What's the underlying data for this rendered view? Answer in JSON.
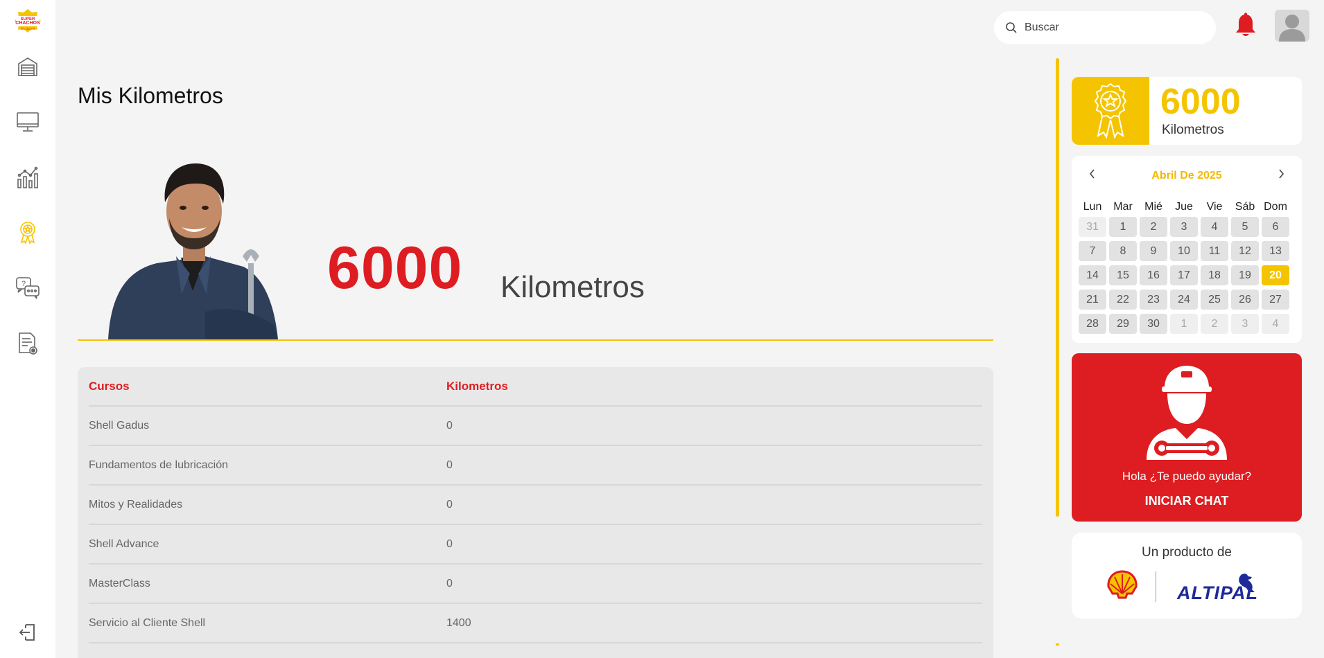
{
  "sidebar": {
    "logo_text": [
      "SUPER",
      "CHACHOS",
      "DEL MOTOR"
    ],
    "items": [
      {
        "icon": "garage-icon"
      },
      {
        "icon": "monitor-icon"
      },
      {
        "icon": "stats-icon"
      },
      {
        "icon": "award-icon",
        "active": true
      },
      {
        "icon": "chat-help-icon"
      },
      {
        "icon": "document-icon"
      }
    ],
    "logout_icon": "logout-icon"
  },
  "header": {
    "search_placeholder": "Buscar",
    "bell_icon": "bell-icon",
    "avatar_icon": "user-icon"
  },
  "main": {
    "title": "Mis Kilometros",
    "hero_value": "6000",
    "hero_unit": "Kilometros",
    "table": {
      "headers": [
        "Cursos",
        "Kilometros"
      ],
      "rows": [
        {
          "course": "Shell Gadus",
          "km": "0"
        },
        {
          "course": "Fundamentos de lubricación",
          "km": "0"
        },
        {
          "course": "Mitos y Realidades",
          "km": "0"
        },
        {
          "course": "Shell Advance",
          "km": "0"
        },
        {
          "course": "MasterClass",
          "km": "0"
        },
        {
          "course": "Servicio al Cliente Shell",
          "km": "1400"
        }
      ]
    }
  },
  "km_card": {
    "value": "6000",
    "label": "Kilometros"
  },
  "calendar": {
    "title": "Abril De 2025",
    "days_of_week": [
      "Lun",
      "Mar",
      "Mié",
      "Jue",
      "Vie",
      "Sáb",
      "Dom"
    ],
    "weeks": [
      [
        "31",
        "1",
        "2",
        "3",
        "4",
        "5",
        "6"
      ],
      [
        "7",
        "8",
        "9",
        "10",
        "11",
        "12",
        "13"
      ],
      [
        "14",
        "15",
        "16",
        "17",
        "18",
        "19",
        "20"
      ],
      [
        "21",
        "22",
        "23",
        "24",
        "25",
        "26",
        "27"
      ],
      [
        "28",
        "29",
        "30",
        "1",
        "2",
        "3",
        "4"
      ]
    ],
    "today": "20"
  },
  "chat": {
    "greeting": "Hola ¿Te puedo ayudar?",
    "cta": "INICIAR CHAT"
  },
  "brand": {
    "text": "Un producto de",
    "partner": "ALTIPAL"
  },
  "colors": {
    "accent": "#f5c400",
    "brand_red": "#dd1d21",
    "page_bg": "#f4f4f4"
  }
}
